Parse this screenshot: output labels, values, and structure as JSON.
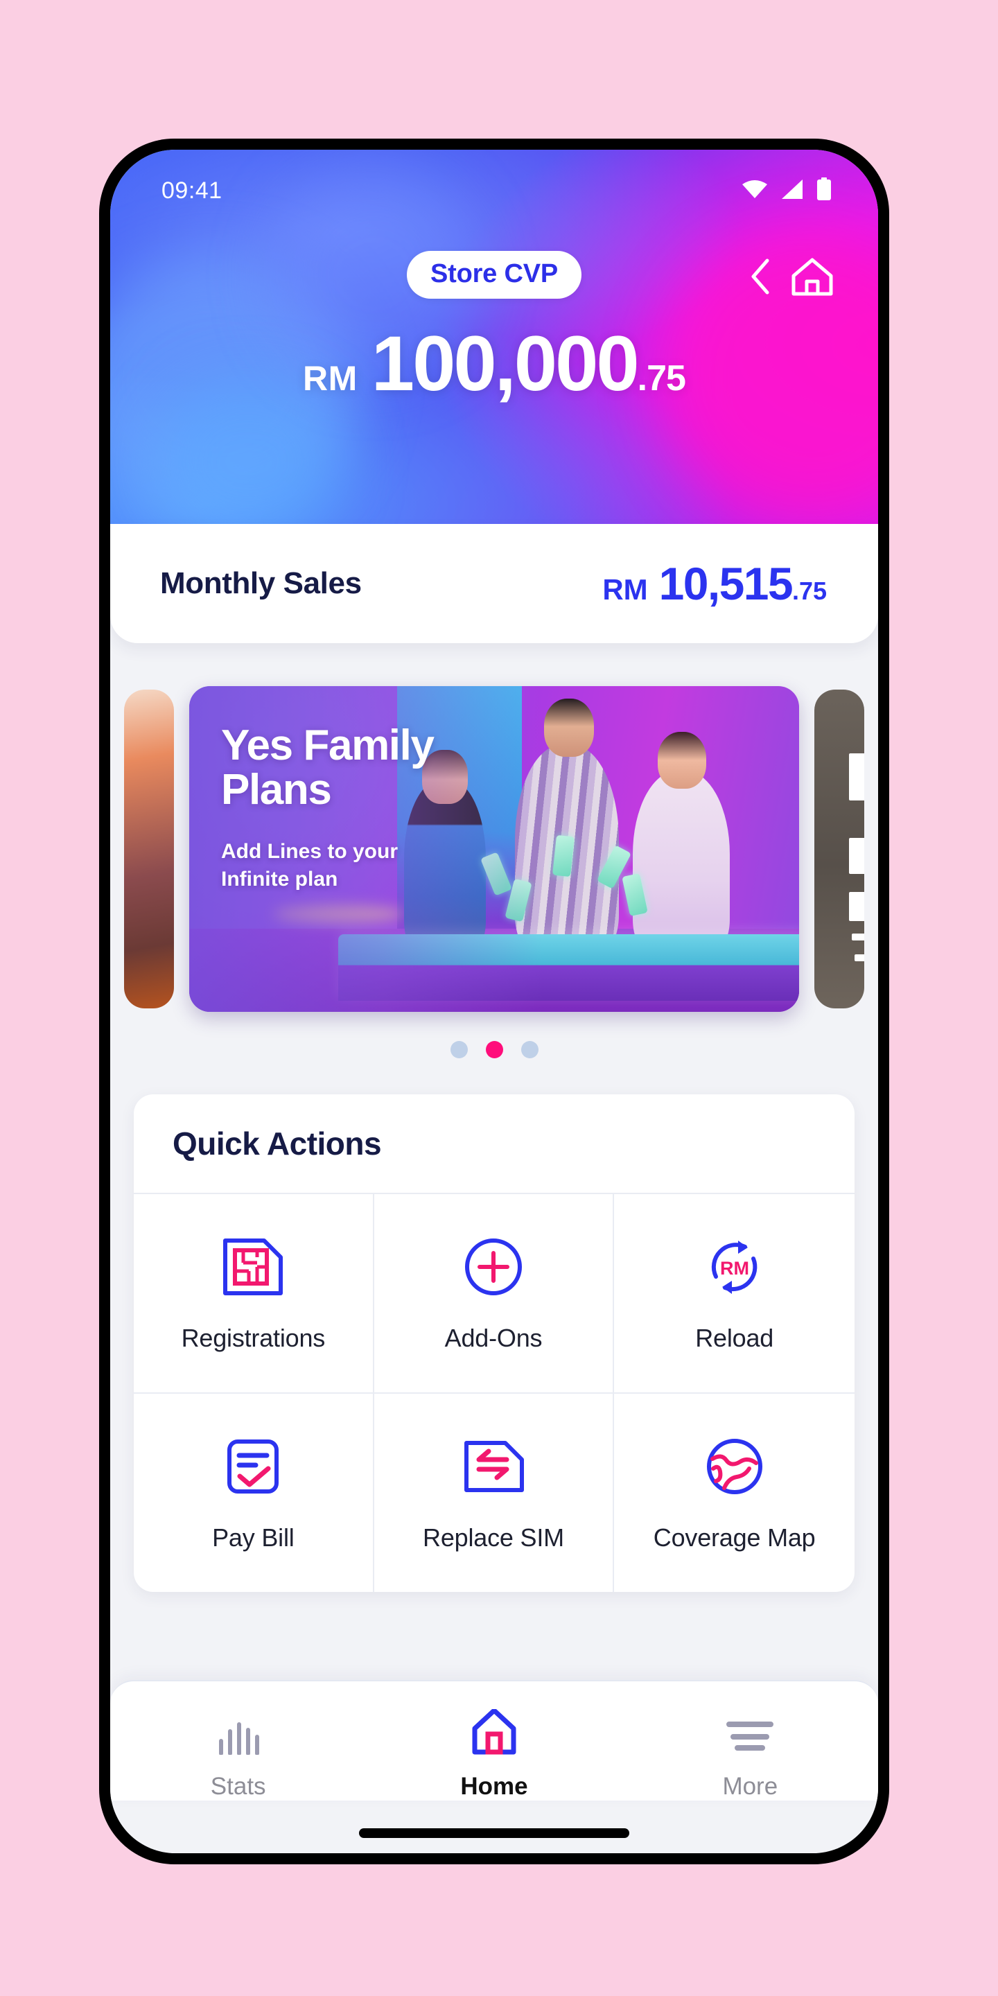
{
  "status_bar": {
    "time": "09:41",
    "icons": [
      "wifi-icon",
      "cellular-signal-icon",
      "battery-icon"
    ]
  },
  "hero": {
    "back_icon": "chevron-left-icon",
    "home_icon": "home-icon",
    "badge_label": "Store CVP",
    "currency": "RM",
    "amount_integer": "100,000",
    "amount_decimal": ".75"
  },
  "monthly_sales": {
    "label": "Monthly Sales",
    "currency": "RM",
    "amount_integer": "10,515",
    "amount_decimal": ".75"
  },
  "carousel": {
    "active_slide": {
      "title": "Yes Family Plans",
      "subtitle": "Add Lines to your Infinite plan"
    },
    "dots": [
      {
        "active": false
      },
      {
        "active": true
      },
      {
        "active": false
      }
    ]
  },
  "quick_actions": {
    "title": "Quick Actions",
    "items": [
      {
        "label": "Registrations",
        "icon": "sim-card-icon"
      },
      {
        "label": "Add-Ons",
        "icon": "plus-circle-icon"
      },
      {
        "label": "Reload",
        "icon": "reload-rm-icon"
      },
      {
        "label": "Pay Bill",
        "icon": "bill-check-icon"
      },
      {
        "label": "Replace SIM",
        "icon": "swap-sim-icon"
      },
      {
        "label": "Coverage Map",
        "icon": "globe-icon"
      }
    ]
  },
  "bottom_nav": {
    "items": [
      {
        "label": "Stats",
        "icon": "bar-chart-icon",
        "active": false
      },
      {
        "label": "Home",
        "icon": "home-icon",
        "active": true
      },
      {
        "label": "More",
        "icon": "hamburger-icon",
        "active": false
      }
    ]
  },
  "colors": {
    "accent_blue": "#2B33EF",
    "accent_pink": "#FF0D7B",
    "dark_navy": "#161B46",
    "page_background": "#FBCFE3",
    "surface": "#F2F3F7"
  }
}
